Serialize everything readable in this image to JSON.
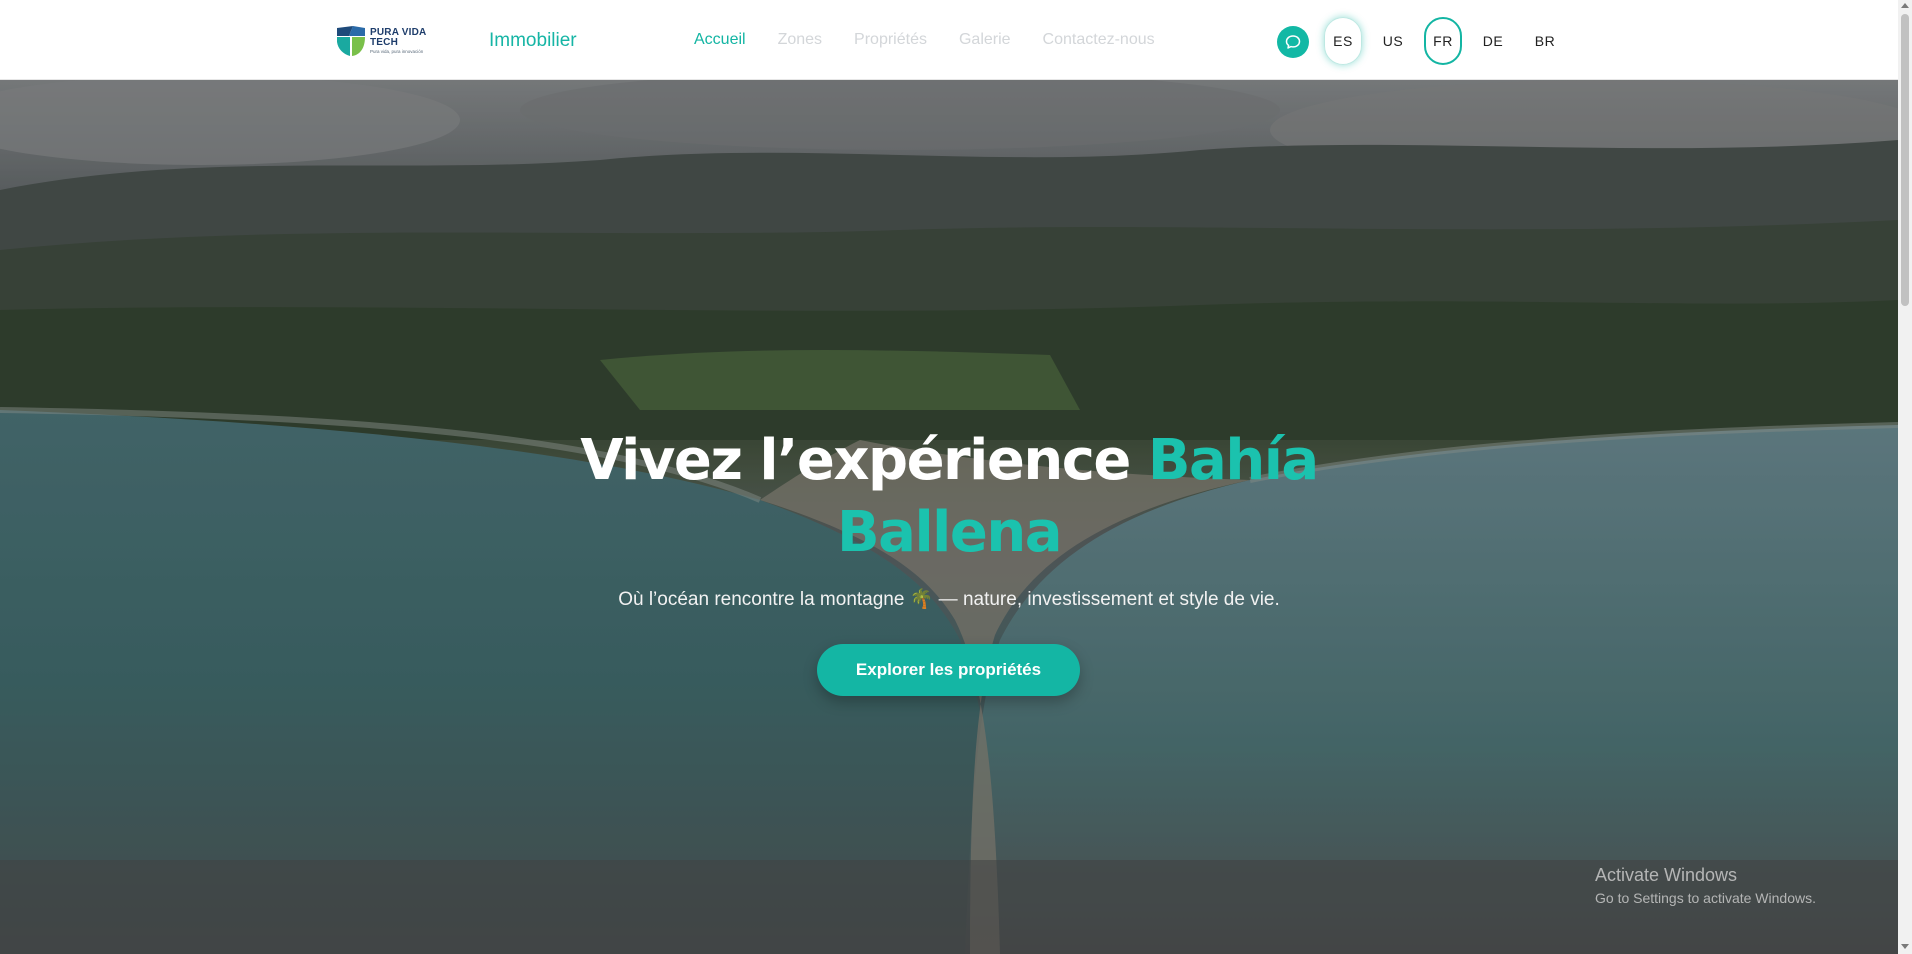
{
  "header": {
    "logo": {
      "title_line1": "PURA VIDA",
      "title_line2": "TECH",
      "tagline": "Pura vida, pura innovación"
    },
    "brand_label": "Immobilier",
    "nav": [
      {
        "label": "Accueil",
        "active": true
      },
      {
        "label": "Zones",
        "active": false
      },
      {
        "label": "Propriétés",
        "active": false
      },
      {
        "label": "Galerie",
        "active": false
      },
      {
        "label": "Contactez-nous",
        "active": false
      }
    ],
    "chat_icon": "chat-bubble-icon",
    "languages": [
      {
        "code": "ES",
        "state": "hover"
      },
      {
        "code": "US",
        "state": "default"
      },
      {
        "code": "FR",
        "state": "selected"
      },
      {
        "code": "DE",
        "state": "default"
      },
      {
        "code": "BR",
        "state": "default"
      }
    ]
  },
  "hero": {
    "title_prefix": "Vivez l’expérience ",
    "title_accent_1": "Bahía",
    "title_accent_2": "Ballena",
    "subtitle_before": "Où l’océan rencontre la montagne ",
    "subtitle_emoji": "🌴",
    "subtitle_after": " — nature, investissement et style de vie.",
    "cta_label": "Explorer les propriétés"
  },
  "watermark": {
    "line1": "Activate Windows",
    "line2": "Go to Settings to activate Windows."
  },
  "colors": {
    "accent": "#13b5a3",
    "nav_inactive": "#d3d6d9",
    "header_bg": "#ffffff"
  }
}
